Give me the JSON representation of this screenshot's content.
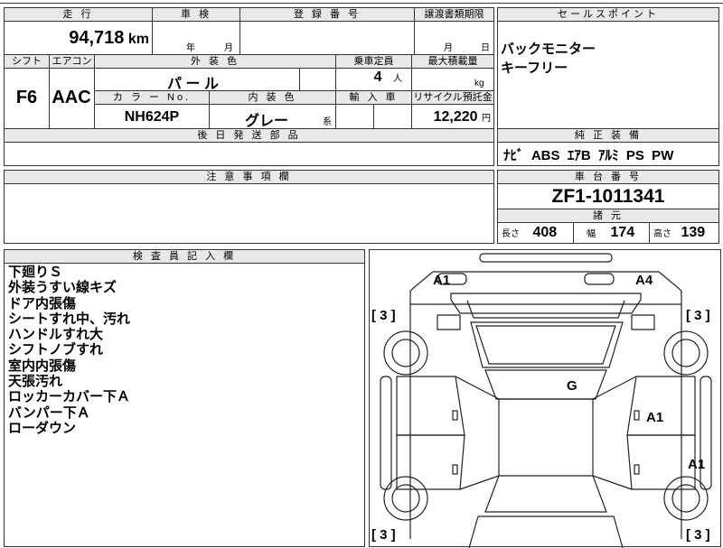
{
  "sheet": {
    "labels": {
      "mileage": "走 行",
      "inspection": "車 検",
      "registration": "登 録 番 号",
      "transfer_deadline": "譲渡書類期限",
      "sales_point": "セールスポイント",
      "shift": "シフト",
      "aircon": "エアコン",
      "exterior_color": "外 装 色",
      "capacity": "乗車定員",
      "max_load": "最大積載量",
      "color_no": "カ ラ ー No.",
      "interior_color": "内 装 色",
      "import": "輸 入 車",
      "recycle": "リサイクル預託金",
      "later_parts": "後 日 発 送 部 品",
      "factory_equipment": "純 正 装 備",
      "caution": "注 意 事 項 欄",
      "chassis_no": "車 台 番 号",
      "specs": "諸 元",
      "inspector_notes": "検 査 員 記 入 欄"
    },
    "mileage": {
      "value": "94,718",
      "unit": "km"
    },
    "inspection_date": {
      "year_unit": "年",
      "month_unit": "月"
    },
    "transfer_month_unit": "月",
    "transfer_day_unit": "日",
    "shift": "F6",
    "aircon": "AAC",
    "exterior_color": "パ ー ル",
    "capacity": {
      "value": "4",
      "unit": "人"
    },
    "max_load_unit": "kg",
    "color_no": "NH624P",
    "interior_color": {
      "value": "グレー",
      "suffix": "系"
    },
    "recycle": {
      "value": "12,220",
      "unit": "円"
    },
    "sales_points": [
      "バックモニター",
      "キーフリー"
    ],
    "factory_equipment": "ﾅﾋﾞ  ABS  ｴｱB  ｱﾙﾐ  PS  PW",
    "chassis_no": "ZF1-1011341",
    "specs": {
      "length_label": "長さ",
      "length": "408",
      "width_label": "幅",
      "width": "174",
      "height_label": "高さ",
      "height": "139"
    },
    "inspector_notes": [
      "下廻りＳ",
      "外装うすい線キズ",
      "ドア内張傷",
      "シートすれ中、汚れ",
      "ハンドルすれ大",
      "シフトノブすれ",
      "室内内張傷",
      "天張汚れ",
      "ロッカーカバー下Ａ",
      "バンパー下Ａ",
      "ローダウン"
    ],
    "diagram": {
      "marks": [
        "A1",
        "A4",
        "G",
        "A1",
        "A1"
      ],
      "tire_brackets": [
        "[ 3 ]",
        "[ 3 ]",
        "[ 3 ]",
        "[ 3 ]"
      ]
    }
  }
}
